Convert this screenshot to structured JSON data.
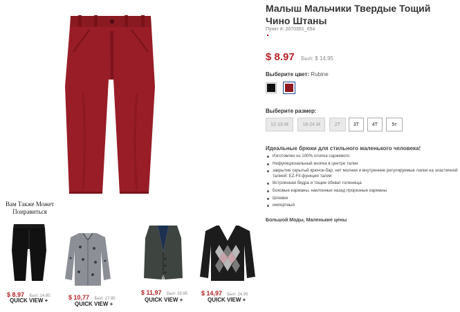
{
  "product": {
    "title": "Малыш Мальчики Твердые Тощий Чино Штаны",
    "sku": "Пункт #: 2070351_054",
    "price": "$ 8.97",
    "was_price": "Был: $ 14,95",
    "color_label": "Выберите цвет:",
    "color_value": "Rubine",
    "swatches": [
      {
        "name": "black",
        "color": "#111111"
      },
      {
        "name": "rubine",
        "color": "#8f1a22"
      }
    ],
    "size_label": "Выберите размер:",
    "sizes": [
      {
        "label": "12-18 M",
        "available": false
      },
      {
        "label": "18-24 M",
        "available": false
      },
      {
        "label": "2T",
        "available": false
      },
      {
        "label": "3T",
        "available": true
      },
      {
        "label": "4T",
        "available": true
      },
      {
        "label": "5т",
        "available": true
      }
    ],
    "description_title": "Идеальные брюки для стильного маленького человека!",
    "bullets": [
      "Изготовлен из 100% хлопка саржевого",
      "Нефункциональный кнопка в центре талии",
      "закрытие скрытый крючок-бар, нет молнии и внутренние регулируемые лапки на эластичной талией: EZ-Fit функции талии",
      "Встроенная бедра и тощие обхват голенища",
      "Боковые карманы, наклонные назад прорезные карманы",
      "Шлевки",
      "импортный"
    ],
    "footer_note": "Большой Моды, Маленькие цены"
  },
  "recommendations": {
    "title": "Вам Также Может Понравиться",
    "items": [
      {
        "price": "$ 8.97",
        "was": "Был: 14.95",
        "quick_view": "QUICK VIEW +"
      },
      {
        "price": "$ 10,77",
        "was": "Был: 17.95",
        "quick_view": "QUICK VIEW +"
      },
      {
        "price": "$ 11,97",
        "was": "Был: 19.95",
        "quick_view": "QUICK VIEW +"
      },
      {
        "price": "$ 14,97",
        "was": "Был: 24.95",
        "quick_view": "QUICK VIEW +"
      }
    ]
  },
  "colors": {
    "accent_price": "#b51f24",
    "selected_border": "#1c3f8c"
  }
}
